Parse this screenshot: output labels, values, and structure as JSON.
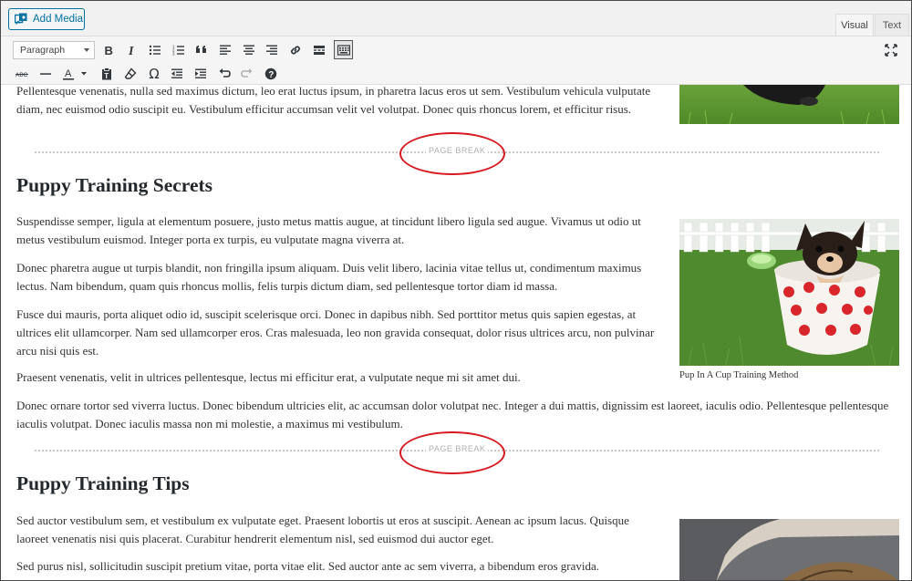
{
  "topbar": {
    "add_media_label": "Add Media",
    "tabs": [
      {
        "label": "Visual"
      },
      {
        "label": "Text"
      }
    ]
  },
  "toolbar": {
    "format_select_value": "Paragraph",
    "row1_icons": [
      "bold-icon",
      "italic-icon",
      "bulleted-list-icon",
      "numbered-list-icon",
      "blockquote-icon",
      "align-left-icon",
      "align-center-icon",
      "align-right-icon",
      "link-icon",
      "read-more-icon",
      "toolbar-toggle-icon"
    ],
    "row2_icons": [
      "strikethrough-icon",
      "horizontal-line-icon",
      "text-color-icon",
      "paste-as-text-icon",
      "clear-formatting-icon",
      "special-character-icon",
      "decrease-indent-icon",
      "increase-indent-icon",
      "undo-icon",
      "redo-icon",
      "help-icon"
    ],
    "fullscreen_icon": "fullscreen-icon",
    "text_color_letter": "A",
    "omega": "Ω",
    "help": "?"
  },
  "content": {
    "top_para": "Pellentesque venenatis, nulla sed maximus dictum, leo erat luctus ipsum, in pharetra lacus eros ut sem. Vestibulum vehicula vulputate diam, nec euismod odio suscipit eu. Vestibulum efficitur accumsan velit vel volutpat. Donec quis rhoncus lorem, et efficitur risus.",
    "page_break_label": "PAGE BREAK",
    "section1": {
      "heading": "Puppy Training Secrets",
      "paragraphs": [
        "Suspendisse semper, ligula at elementum posuere, justo metus mattis augue, at tincidunt libero ligula sed augue. Vivamus ut odio ut metus vestibulum euismod. Integer porta ex turpis, eu vulputate magna viverra at.",
        "Donec pharetra augue ut turpis blandit, non fringilla ipsum aliquam. Duis velit libero, lacinia vitae tellus ut, condimentum maximus lectus. Nam bibendum, quam quis rhoncus mollis, felis turpis dictum diam, sed pellentesque tortor diam id massa.",
        "Fusce dui mauris, porta aliquet odio id, suscipit scelerisque orci. Donec in dapibus nibh. Sed porttitor metus quis sapien egestas, at ultrices elit ullamcorper. Nam sed ullamcorper eros. Cras malesuada, leo non gravida consequat, dolor risus ultrices arcu, non pulvinar arcu nisi quis est.",
        "Praesent venenatis, velit in ultrices pellentesque, lectus mi efficitur erat, a vulputate neque mi sit amet dui.",
        "Donec ornare tortor sed viverra luctus. Donec bibendum ultricies elit, ac accumsan dolor volutpat nec. Integer a dui mattis, dignissim est laoreet, iaculis odio. Pellentesque pellentesque iaculis volutpat. Donec iaculis massa non mi molestie, a maximus mi vestibulum."
      ],
      "image_caption": "Pup In A Cup Training Method"
    },
    "section2": {
      "heading": "Puppy Training Tips",
      "paragraphs": [
        "Sed auctor vestibulum sem, et vestibulum ex vulputate eget. Praesent lobortis ut eros at suscipit. Aenean ac ipsum lacus. Quisque laoreet venenatis nisi quis placerat. Curabitur hendrerit elementum nisl, sed euismod dui auctor eget.",
        "Sed purus nisl, sollicitudin suscipit pretium vitae, porta vitae elit. Sed auctor ante ac sem viverra, a bibendum eros gravida."
      ]
    }
  },
  "colors": {
    "accent_blue": "#0071a1",
    "highlight_red": "#d71920",
    "grass_green": "#4a8a2a",
    "cup_red": "#d8262c"
  }
}
